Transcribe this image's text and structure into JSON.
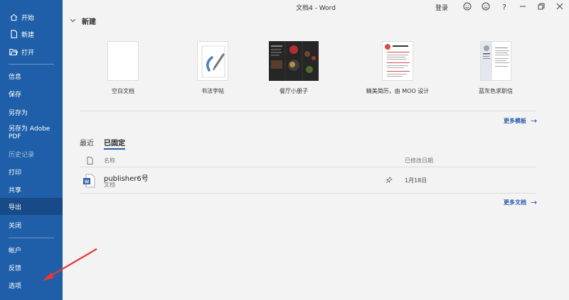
{
  "window": {
    "title": "文档4 - Word",
    "login": "登录",
    "controls": [
      "smile-icon",
      "frown-icon",
      "help-icon",
      "minimize-icon",
      "restore-icon",
      "close-icon"
    ],
    "help_glyph": "?"
  },
  "sidebar": {
    "items": [
      {
        "label": "开始",
        "icon": "home-icon"
      },
      {
        "label": "新建",
        "icon": "new-document-icon"
      },
      {
        "label": "打开",
        "icon": "folder-open-icon"
      },
      {
        "label": "信息"
      },
      {
        "label": "保存"
      },
      {
        "label": "另存为"
      },
      {
        "label": "另存为 Adobe PDF"
      },
      {
        "label": "历史记录",
        "disabled": true
      },
      {
        "label": "打印"
      },
      {
        "label": "共享"
      },
      {
        "label": "导出",
        "active": true
      },
      {
        "label": "关闭"
      },
      {
        "label": "帐户"
      },
      {
        "label": "反馈"
      },
      {
        "label": "选项"
      }
    ],
    "colors": {
      "bg": "#1f5fa9",
      "active": "#174a86"
    }
  },
  "new_section": {
    "heading": "新建",
    "templates": [
      {
        "label": "空白文档"
      },
      {
        "label": "书法字帖"
      },
      {
        "label": "餐厅小册子"
      },
      {
        "label": "精美简历，由 MOO 设计"
      },
      {
        "label": "蓝灰色求职信"
      }
    ],
    "more_templates": "更多模板"
  },
  "recent": {
    "tabs": [
      {
        "label": "最近",
        "active": false
      },
      {
        "label": "已固定",
        "active": true
      }
    ],
    "columns": {
      "name": "名称",
      "modified": "已修改日期"
    },
    "files": [
      {
        "name": "publisher6号",
        "type": "文档",
        "date": "1月18日",
        "pinned": true
      }
    ],
    "more_docs": "更多文档"
  },
  "accent_color": "#2b5aa8",
  "annotation_color": "#e53935"
}
